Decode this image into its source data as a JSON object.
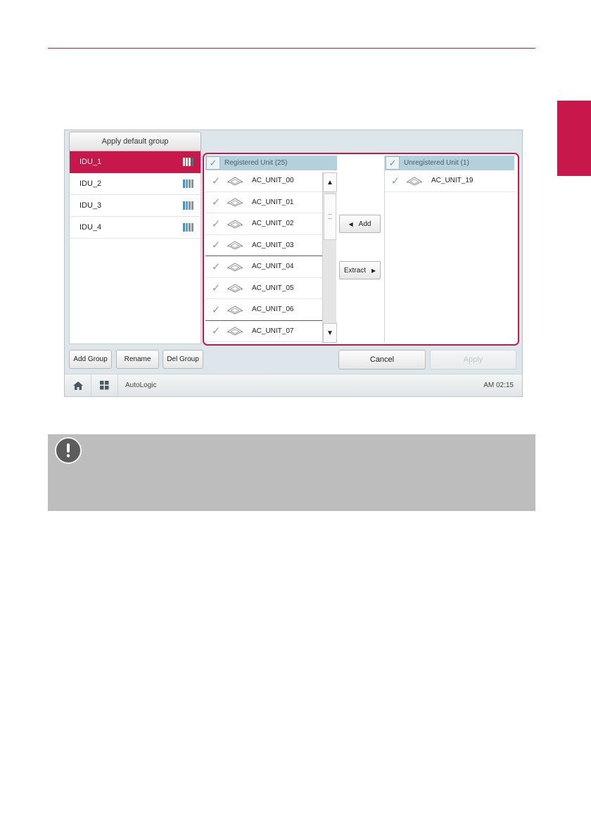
{
  "apply_default_label": "Apply default group",
  "groups": [
    {
      "name": "IDU_1",
      "selected": true
    },
    {
      "name": "IDU_2",
      "selected": false
    },
    {
      "name": "IDU_3",
      "selected": false
    },
    {
      "name": "IDU_4",
      "selected": false
    }
  ],
  "registered": {
    "header": "Registered Unit (25)",
    "units": [
      "AC_UNIT_00",
      "AC_UNIT_01",
      "AC_UNIT_02",
      "AC_UNIT_03",
      "AC_UNIT_04",
      "AC_UNIT_05",
      "AC_UNIT_06",
      "AC_UNIT_07"
    ]
  },
  "unregistered": {
    "header": "Unregistered Unit (1)",
    "units": [
      "AC_UNIT_19"
    ]
  },
  "transfer": {
    "add_label": "Add",
    "extract_label": "Extract"
  },
  "group_buttons": {
    "add": "Add Group",
    "rename": "Rename",
    "delete": "Del Group"
  },
  "actions": {
    "cancel": "Cancel",
    "apply": "Apply"
  },
  "statusbar": {
    "app_name": "AutoLogic",
    "time": "AM 02:15"
  },
  "colors": {
    "accent": "#c8174a",
    "header_bg": "#b3d0dc",
    "note_bg": "#bdbdbd"
  },
  "icons": {
    "check": "check-icon",
    "unit": "ceiling-cassette-icon",
    "home": "home-icon",
    "menu": "grid-menu-icon",
    "note": "exclamation-icon"
  }
}
